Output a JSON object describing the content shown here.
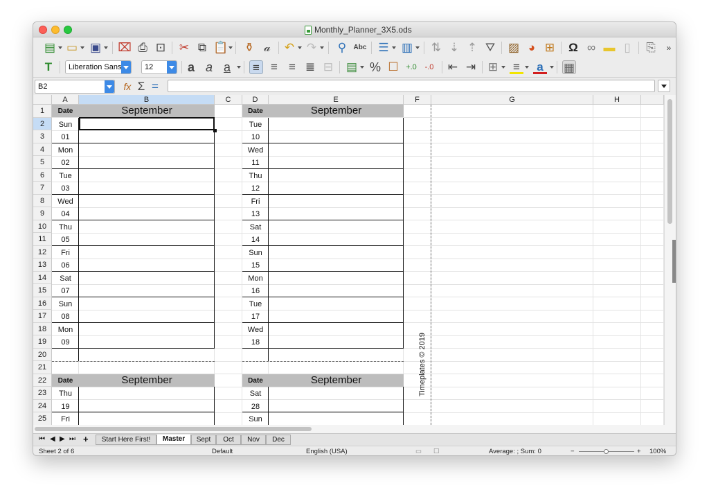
{
  "window": {
    "title": "Monthly_Planner_3X5.ods"
  },
  "toolbar2": {
    "font_name": "Liberation Sans",
    "font_size": "12"
  },
  "formula_bar": {
    "cell_ref": "B2",
    "content": ""
  },
  "columns": [
    "A",
    "B",
    "C",
    "D",
    "E",
    "F",
    "G",
    "H"
  ],
  "rows": [
    "1",
    "2",
    "3",
    "4",
    "5",
    "6",
    "7",
    "8",
    "9",
    "10",
    "11",
    "12",
    "13",
    "14",
    "15",
    "16",
    "17",
    "18",
    "19",
    "20",
    "21",
    "22",
    "23",
    "24",
    "25"
  ],
  "planner": {
    "date_label": "Date",
    "month": "September",
    "block1": {
      "pairs": [
        [
          "Sun",
          "01"
        ],
        [
          "Mon",
          "02"
        ],
        [
          "Tue",
          "03"
        ],
        [
          "Wed",
          "04"
        ],
        [
          "Thu",
          "05"
        ],
        [
          "Fri",
          "06"
        ],
        [
          "Sat",
          "07"
        ],
        [
          "Sun",
          "08"
        ],
        [
          "Mon",
          "09"
        ]
      ]
    },
    "block2": {
      "pairs": [
        [
          "Tue",
          "10"
        ],
        [
          "Wed",
          "11"
        ],
        [
          "Thu",
          "12"
        ],
        [
          "Fri",
          "13"
        ],
        [
          "Sat",
          "14"
        ],
        [
          "Sun",
          "15"
        ],
        [
          "Mon",
          "16"
        ],
        [
          "Tue",
          "17"
        ],
        [
          "Wed",
          "18"
        ]
      ]
    },
    "block3": {
      "pairs": [
        [
          "Thu",
          "19"
        ],
        [
          "Fri",
          ""
        ]
      ]
    },
    "block4": {
      "pairs": [
        [
          "Sat",
          "28"
        ],
        [
          "Sun",
          ""
        ]
      ]
    },
    "watermark": "Timeplates © 2019"
  },
  "sheet_tabs": [
    "Start Here First!",
    "Master",
    "Sept",
    "Oct",
    "Nov",
    "Dec"
  ],
  "active_tab": "Master",
  "status": {
    "sheet": "Sheet 2 of 6",
    "style": "Default",
    "language": "English (USA)",
    "summary": "Average: ; Sum: 0",
    "zoom": "100%"
  }
}
